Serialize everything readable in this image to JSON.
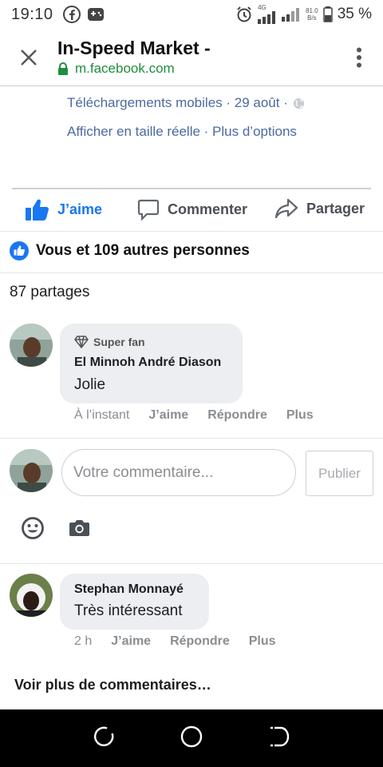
{
  "status_bar": {
    "time": "19:10",
    "network_type": "4G",
    "net_speed_value": "81.0",
    "net_speed_unit": "B/s",
    "battery": "35 %",
    "icons": [
      "facebook-icon",
      "gamepad-icon",
      "alarm-icon",
      "signal-icon",
      "battery-icon"
    ]
  },
  "browser": {
    "title": "In-Speed Market -",
    "url": "m.facebook.com"
  },
  "post_meta": {
    "line1_prefix": "Téléchargements mobiles · 29 août ·",
    "line2": "Afficher en taille réelle · Plus d’options"
  },
  "actions": {
    "like": "J’aime",
    "comment": "Commenter",
    "share": "Partager"
  },
  "reactions_text": "Vous et 109 autres personnes",
  "shares_text": "87 partages",
  "comments": [
    {
      "badge": "Super fan",
      "author": "El Minnoh André Diason",
      "text": "Jolie",
      "time": "À l’instant",
      "like": "J’aime",
      "reply": "Répondre",
      "more": "Plus"
    },
    {
      "author": "Stephan Monnayé",
      "text": "Très intéressant",
      "time": "2 h",
      "like": "J’aime",
      "reply": "Répondre",
      "more": "Plus"
    }
  ],
  "composer": {
    "placeholder": "Votre commentaire...",
    "publish": "Publier"
  },
  "more_comments": "Voir plus de commentaires…",
  "colors": {
    "facebook_blue": "#1877f2",
    "link_blue": "#4b6aa0",
    "secure_green": "#1e8e3e",
    "bubble_gray": "#eceef1"
  }
}
